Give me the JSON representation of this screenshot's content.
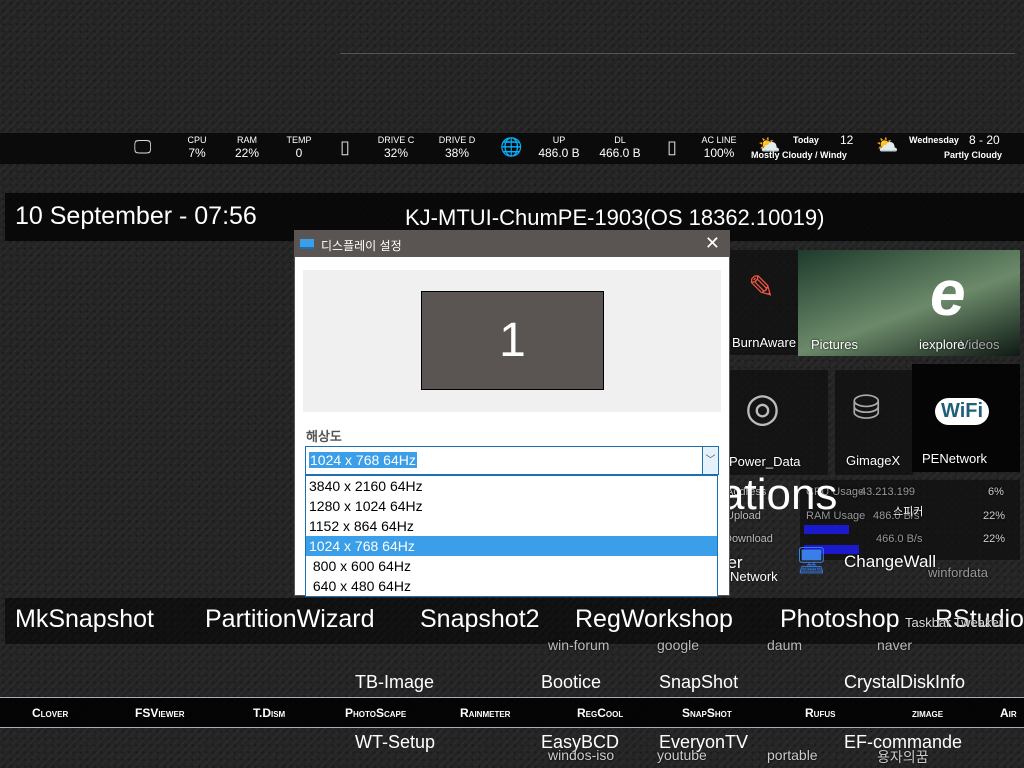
{
  "status_bar": {
    "cpu": {
      "label": "CPU",
      "value": "7%"
    },
    "ram": {
      "label": "RAM",
      "value": "22%"
    },
    "temp": {
      "label": "TEMP",
      "value": "0"
    },
    "drive_c": {
      "label": "DRIVE C",
      "value": "32%"
    },
    "drive_d": {
      "label": "DRIVE D",
      "value": "38%"
    },
    "up": {
      "label": "UP",
      "value": "486.0 B"
    },
    "dl": {
      "label": "DL",
      "value": "466.0 B"
    },
    "ac": {
      "label": "AC LINE",
      "value": "100%"
    },
    "today": {
      "label": "Today",
      "temp": "12",
      "desc": "Mostly Cloudy / Windy"
    },
    "tomorrow": {
      "label": "Wednesday",
      "temp": "8 - 20",
      "desc": "Partly Cloudy"
    }
  },
  "header": {
    "datetime": "10 September - 07:56",
    "hostname": "KJ-MTUI-ChumPE-1903(OS 18362.10019)"
  },
  "dialog": {
    "title": "디스플레이 설정",
    "close": "✕",
    "monitor_number": "1",
    "resolution_label": "해상도",
    "selected": "1024 x 768 64Hz",
    "options": [
      "3840 x 2160 64Hz",
      "1280 x 1024 64Hz",
      "1152 x 864 64Hz",
      "1024 x 768 64Hz",
      " 800 x 600 64Hz",
      " 640 x 480 64Hz"
    ],
    "selected_index": 3
  },
  "tiles": {
    "burnaware": "BurnAware",
    "pictures": "Pictures",
    "iexplore": "iexplore",
    "videos": "Videos",
    "power_data": "Power_Data",
    "gimagex": "GimageX",
    "penetwork": "PENetwork",
    "ations": "ations",
    "speaker": "스피커",
    "address": "Address",
    "cpu_usage": "CPU Usage",
    "ip": "43.213.199",
    "cpu_pct": "6%",
    "upload": "Upload",
    "ram_usage": "RAM Usage",
    "up_rate": "486.0 B/s",
    "ram_pct": "22%",
    "download": "Download",
    "down_rate": "466.0 B/s",
    "swap_pct": "22%",
    "per": "per",
    "network": "Network",
    "changewall": "ChangeWall",
    "winfordata": "winfordata"
  },
  "big_row": [
    "MkSnapshot",
    "PartitionWizard",
    "Snapshot2",
    "RegWorkshop",
    "Photoshop",
    "RStudio"
  ],
  "small_row": [
    "win-forum",
    "google",
    "daum",
    "naver",
    "Taskbar Tweaker"
  ],
  "row_mid": [
    "TB-Image",
    "Bootice",
    "SnapShot",
    "CrystalDiskInfo"
  ],
  "row_bottom": [
    "WT-Setup",
    "EasyBCD",
    "EveryonTV",
    "EF-commande"
  ],
  "row_bottom_sub": [
    "windos-iso",
    "youtube",
    "portable",
    "용자의꿈"
  ],
  "launcher": [
    "Clover",
    "FSViewer",
    "T.Dism",
    "PhotoScape",
    "Rainmeter",
    "RegCool",
    "SnapShot",
    "Rufus",
    "zimage",
    "Air"
  ]
}
